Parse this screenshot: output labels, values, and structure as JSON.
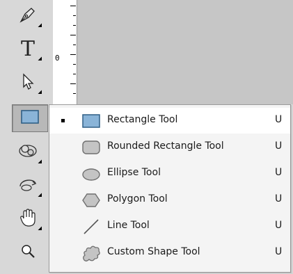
{
  "toolbar": {
    "tools": [
      {
        "name": "pen-tool",
        "icon": "pen-icon",
        "has_flyout": true
      },
      {
        "name": "type-tool",
        "icon": "type-icon",
        "glyph": "T",
        "has_flyout": true
      },
      {
        "name": "path-selection-tool",
        "icon": "arrow-icon",
        "has_flyout": true
      },
      {
        "name": "rectangle-shape-tool",
        "icon": "rectangle-icon",
        "active": true
      },
      {
        "name": "3d-rotate-tool",
        "icon": "3d-object-icon",
        "has_flyout": true
      },
      {
        "name": "3d-orbit-tool",
        "icon": "3d-orbit-icon",
        "has_flyout": true
      },
      {
        "name": "hand-tool",
        "icon": "hand-icon",
        "has_flyout": true
      },
      {
        "name": "zoom-tool",
        "icon": "magnifier-icon"
      }
    ]
  },
  "ruler": {
    "zero_label": "0"
  },
  "flyout_menu": {
    "items": [
      {
        "label": "Rectangle Tool",
        "shortcut": "U",
        "icon": "rectangle-icon",
        "selected": true
      },
      {
        "label": "Rounded Rectangle Tool",
        "shortcut": "U",
        "icon": "rounded-rectangle-icon",
        "selected": false
      },
      {
        "label": "Ellipse Tool",
        "shortcut": "U",
        "icon": "ellipse-icon",
        "selected": false
      },
      {
        "label": "Polygon Tool",
        "shortcut": "U",
        "icon": "polygon-icon",
        "selected": false
      },
      {
        "label": "Line Tool",
        "shortcut": "U",
        "icon": "line-icon",
        "selected": false
      },
      {
        "label": "Custom Shape Tool",
        "shortcut": "U",
        "icon": "custom-shape-icon",
        "selected": false
      }
    ]
  },
  "colors": {
    "shape_fill_blue": "#8ab4d8",
    "shape_stroke_blue": "#2f5f86",
    "shape_fill_gray": "#c4c4c4",
    "shape_stroke_gray": "#6f6f6f"
  }
}
